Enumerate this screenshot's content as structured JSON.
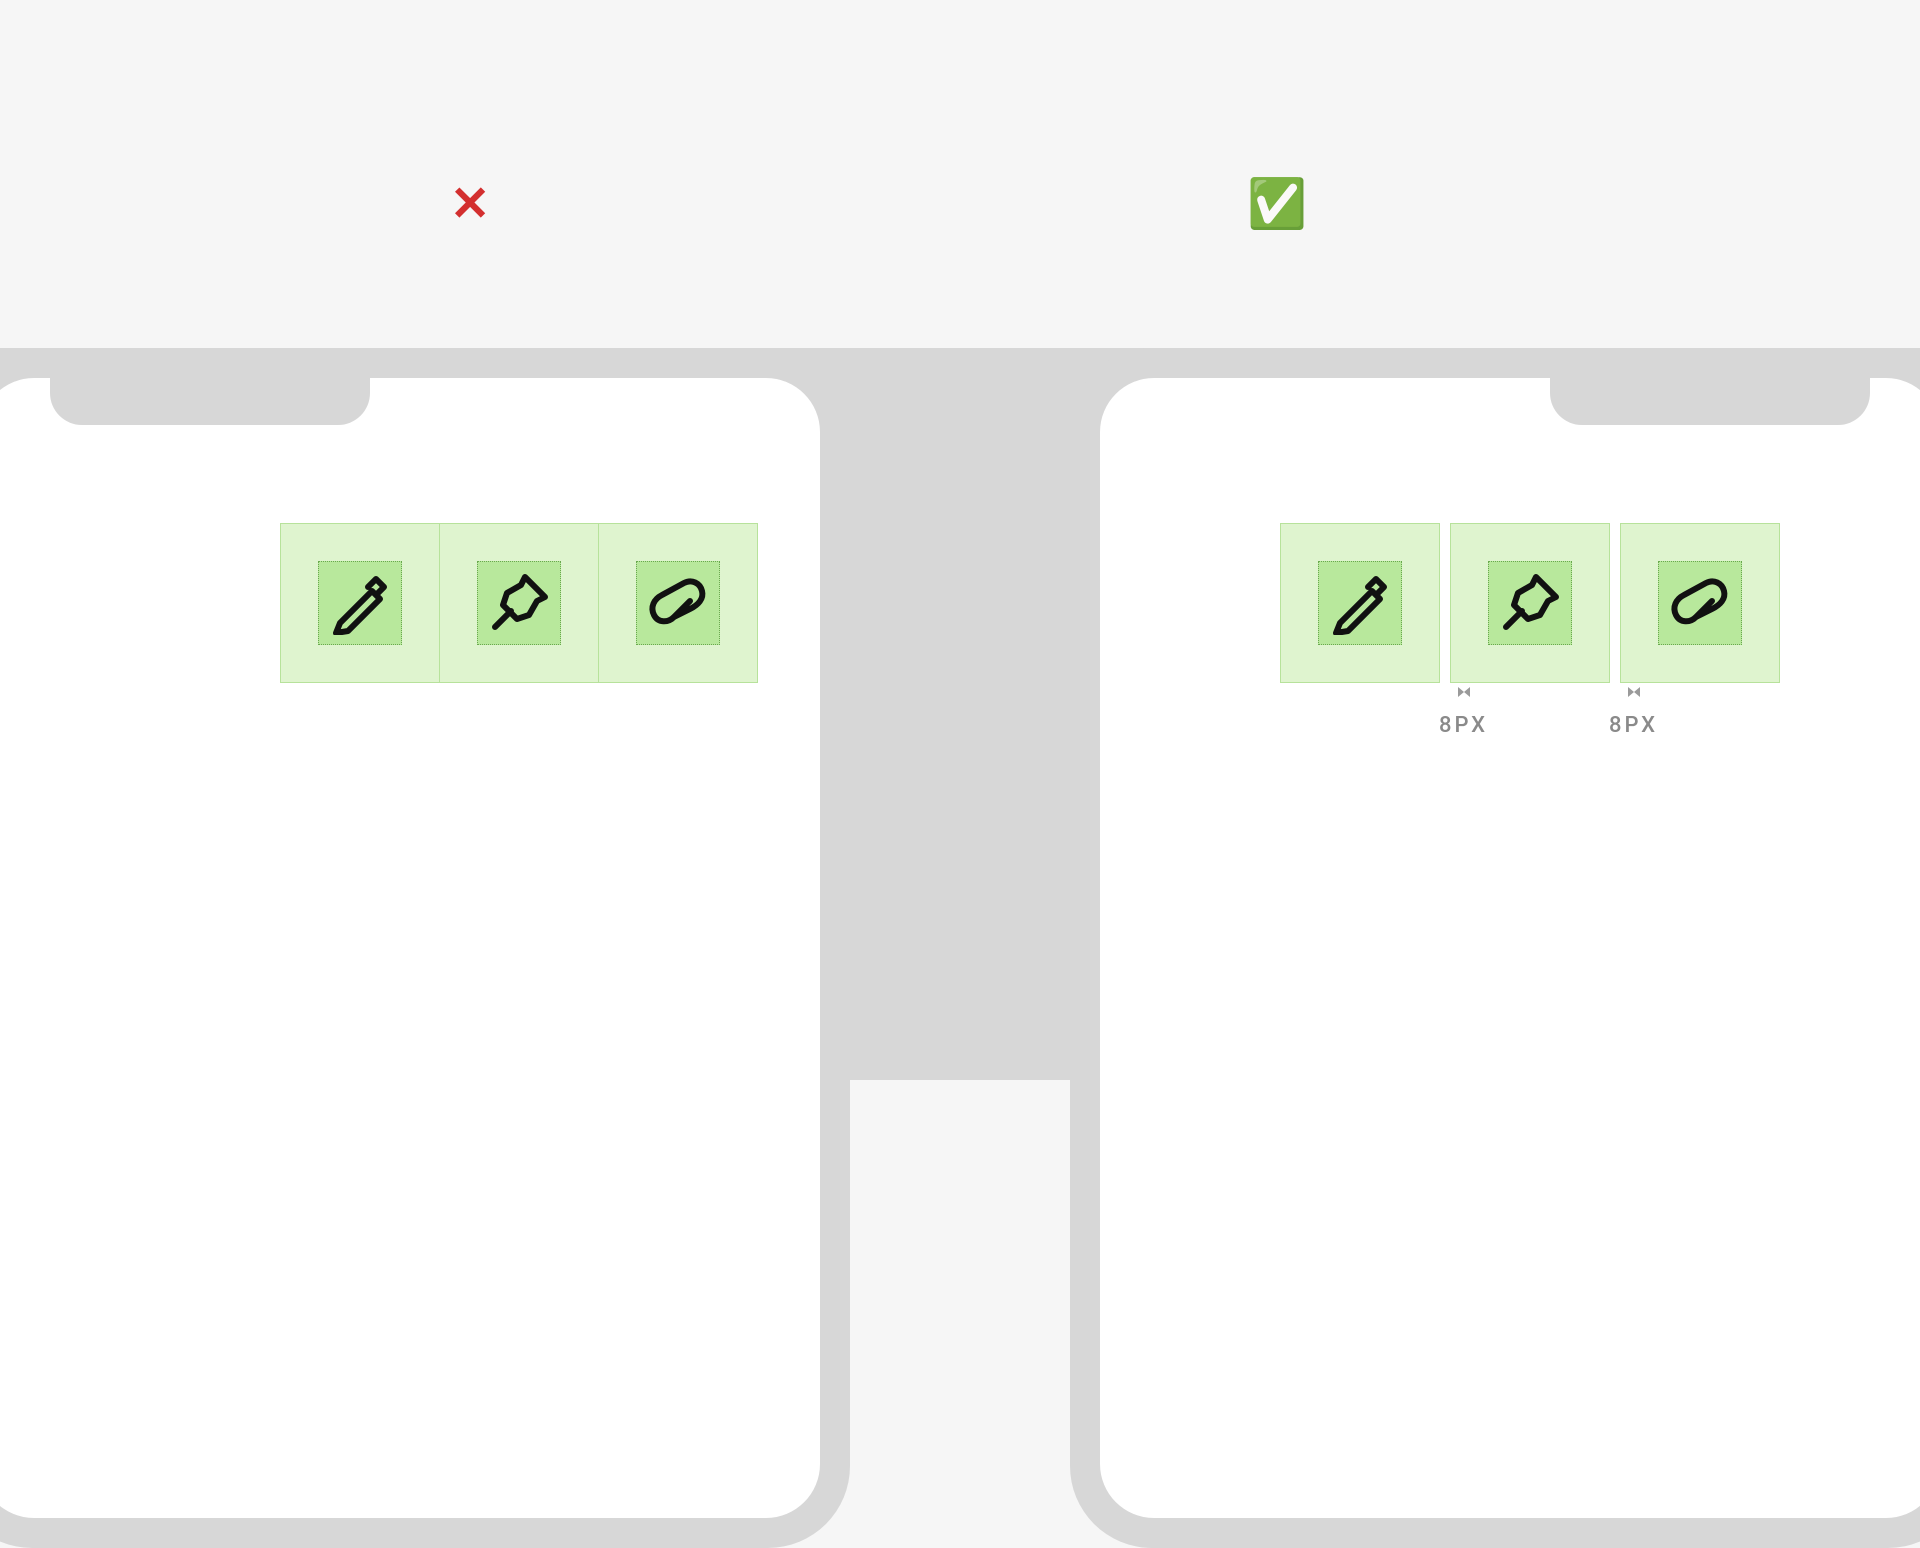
{
  "indicators": {
    "bad_glyph": "✕",
    "good_glyph": "✅"
  },
  "spacing": {
    "gap1_label": "8PX",
    "gap2_label": "8PX"
  },
  "icons": {
    "pencil": "pencil-icon",
    "pin": "pin-icon",
    "clip": "clip-icon"
  }
}
